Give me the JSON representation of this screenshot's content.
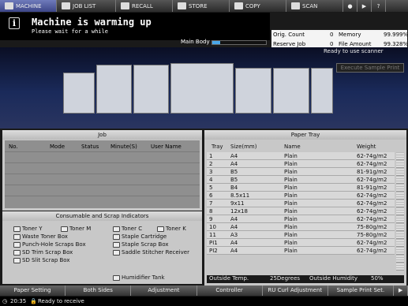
{
  "tabs": [
    {
      "label": "MACHINE",
      "icon": "printer-icon"
    },
    {
      "label": "JOB LIST",
      "icon": "list-icon"
    },
    {
      "label": "RECALL",
      "icon": "recall-icon"
    },
    {
      "label": "STORE",
      "icon": "store-icon"
    },
    {
      "label": "COPY",
      "icon": "copy-icon"
    },
    {
      "label": "SCAN",
      "icon": "scan-icon"
    }
  ],
  "message": {
    "title": "Machine is warming up",
    "subtitle": "Please wait for a while"
  },
  "main_body": {
    "label": "Main Body",
    "progress": 0.15
  },
  "counters": {
    "orig_label": "Orig. Count",
    "orig_value": "0",
    "reserve_label": "Reserve Job",
    "reserve_value": "0",
    "memory_label": "Memory",
    "memory_value": "99.999%",
    "file_label": "File Amount",
    "file_value": "99.328%"
  },
  "ready_scanner": "Ready to use scanner",
  "execute_sample": "Execute Sample Print",
  "job": {
    "title": "Job",
    "cols": [
      "No.",
      "Mode",
      "Status",
      "Minute(S)",
      "User Name"
    ]
  },
  "consumables": {
    "title": "Consumable and Scrap Indicators",
    "items": [
      "Toner Y",
      "Toner M",
      "Toner C",
      "Toner K",
      "Waste Toner Box",
      "Staple Cartridge",
      "Punch-Hole Scraps Box",
      "Staple Scrap Box",
      "SD Trim Scrap Box",
      "Saddle Stitcher Receiver",
      "SD Slit Scrap Box",
      "Humidifier Tank"
    ]
  },
  "tray": {
    "title": "Paper Tray",
    "cols": [
      "Tray",
      "Size(mm)",
      "Name",
      "Weight"
    ],
    "rows": [
      [
        "1",
        "A4",
        "Plain",
        "62-74g/m2"
      ],
      [
        "2",
        "A4",
        "Plain",
        "62-74g/m2"
      ],
      [
        "3",
        "B5",
        "Plain",
        "81-91g/m2"
      ],
      [
        "4",
        "B5",
        "Plain",
        "62-74g/m2"
      ],
      [
        "5",
        "B4",
        "Plain",
        "81-91g/m2"
      ],
      [
        "6",
        "8.5x11",
        "Plain",
        "62-74g/m2"
      ],
      [
        "7",
        "9x11",
        "Plain",
        "62-74g/m2"
      ],
      [
        "8",
        "12x18",
        "Plain",
        "62-74g/m2"
      ],
      [
        "9",
        "A4",
        "Plain",
        "62-74g/m2"
      ],
      [
        "10",
        "A4",
        "Plain",
        "75-80g/m2"
      ],
      [
        "11",
        "A3",
        "Plain",
        "75-80g/m2"
      ],
      [
        "PI1",
        "A4",
        "Plain",
        "62-74g/m2"
      ],
      [
        "PI2",
        "A4",
        "Plain",
        "62-74g/m2"
      ]
    ],
    "outside_temp_label": "Outside Temp.",
    "outside_temp_value": "25Degrees",
    "outside_hum_label": "Outside Humidity",
    "outside_hum_value": "50%"
  },
  "bottom_buttons": [
    "Paper Setting",
    "Both Sides",
    "Adjustment",
    "Controller",
    "RU Curl Adjustment",
    "Sample Print Set."
  ],
  "status": {
    "time": "20:35",
    "text": "Ready to receive"
  }
}
